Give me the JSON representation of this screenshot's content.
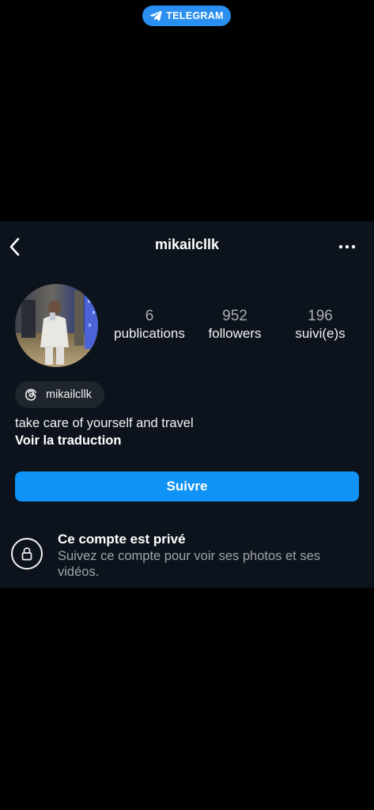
{
  "telegram_badge": {
    "label": "TELEGRAM",
    "icon": "telegram-paper-plane-icon",
    "color": "#2a8ff0"
  },
  "header": {
    "username": "mikailcllk",
    "back_icon": "chevron-left-icon",
    "more_icon": "more-horizontal-icon"
  },
  "profile": {
    "avatar": "profile-photo",
    "stats": [
      {
        "value": "6",
        "label": "publications"
      },
      {
        "value": "952",
        "label": "followers"
      },
      {
        "value": "196",
        "label": "suivi(e)s"
      }
    ],
    "threads_chip": {
      "icon": "threads-icon",
      "label": "mikailcllk"
    },
    "bio": "take care of yourself and travel",
    "see_translation": "Voir la traduction"
  },
  "actions": {
    "follow_label": "Suivre",
    "follow_color": "#0f93f6"
  },
  "private_notice": {
    "icon": "lock-icon",
    "title": "Ce compte est privé",
    "description": "Suivez ce compte pour voir ses photos et ses vidéos."
  }
}
